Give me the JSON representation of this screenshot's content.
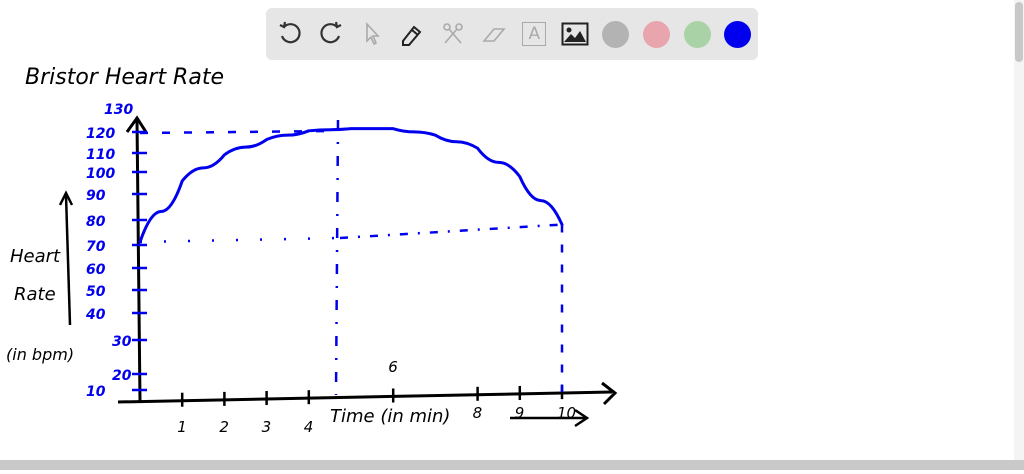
{
  "toolbar": {
    "tools": [
      {
        "name": "undo-icon",
        "enabled": true
      },
      {
        "name": "redo-icon",
        "enabled": true
      },
      {
        "name": "select-pointer-icon",
        "enabled": false
      },
      {
        "name": "pen-icon",
        "enabled": true
      },
      {
        "name": "scissors-icon",
        "enabled": false
      },
      {
        "name": "eraser-icon",
        "enabled": false
      },
      {
        "name": "text-icon",
        "enabled": false
      },
      {
        "name": "image-icon",
        "enabled": true
      }
    ],
    "colors": [
      "#b3b3b3",
      "#e8a5ad",
      "#a9d3a7",
      "#0000ee"
    ],
    "text_tool_glyph": "A"
  },
  "chart_data": {
    "type": "line",
    "title": "Bristor Heart Rate",
    "xlabel": "Time (in min)",
    "ylabel": [
      "Heart",
      "Rate",
      "(in bpm)"
    ],
    "xlim": [
      0,
      10
    ],
    "ylim": [
      10,
      130
    ],
    "x_ticks": [
      "1",
      "2",
      "3",
      "4",
      "6",
      "8",
      "9",
      "10"
    ],
    "x_tick_values": [
      1,
      2,
      3,
      4,
      6,
      8,
      9,
      10
    ],
    "y_ticks": [
      "130",
      "120",
      "110",
      "100",
      "90",
      "80",
      "70",
      "60",
      "50",
      "40",
      "30",
      "20",
      "10"
    ],
    "x": [
      0,
      1,
      2,
      3,
      4,
      5,
      6,
      7,
      8,
      9,
      10
    ],
    "series": [
      {
        "name": "heart rate",
        "values": [
          70,
          98,
          110,
          117,
          121,
          122,
          122,
          119,
          113,
          100,
          78
        ]
      }
    ],
    "reference_lines": {
      "resting_bpm": 70,
      "peak_bpm": 120,
      "peak_start_min": 4.6,
      "end_min": 10,
      "end_bpm": 78
    },
    "line_color": "#0000ee"
  }
}
